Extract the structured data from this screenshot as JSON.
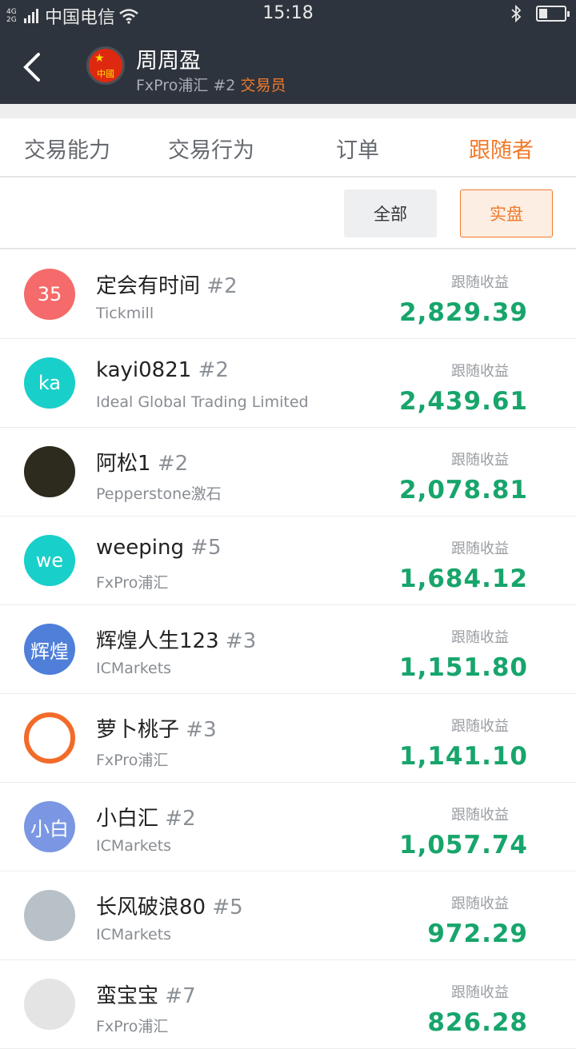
{
  "status": {
    "network": "4G 2G",
    "carrier": "中国电信",
    "time": "15:18"
  },
  "header": {
    "trader_name": "周周盈",
    "flag_text": "中國",
    "broker": "FxPro浦汇",
    "rank": "#2",
    "role": "交易员"
  },
  "tabs": [
    {
      "label": "交易能力"
    },
    {
      "label": "交易行为"
    },
    {
      "label": "订单"
    },
    {
      "label": "跟随者"
    }
  ],
  "filters": {
    "all": "全部",
    "real": "实盘"
  },
  "profit_label": "跟随收益",
  "followers": [
    {
      "avatar_text": "35",
      "avatar_color": "#f56a6a",
      "name": "定会有时间",
      "rank": "#2",
      "broker": "Tickmill",
      "profit": "2,829.39"
    },
    {
      "avatar_text": "ka",
      "avatar_color": "#19cfc9",
      "name": "kayi0821",
      "rank": "#2",
      "broker": "Ideal Global Trading Limited",
      "profit": "2,439.61"
    },
    {
      "avatar_text": "",
      "avatar_color": "#2d2a1e",
      "name": "阿松1",
      "rank": "#2",
      "broker": "Pepperstone激石",
      "profit": "2,078.81"
    },
    {
      "avatar_text": "we",
      "avatar_color": "#19cfc9",
      "name": "weeping",
      "rank": "#5",
      "broker": "FxPro浦汇",
      "profit": "1,684.12"
    },
    {
      "avatar_text": "辉煌",
      "avatar_color": "#4f7fd9",
      "name": "辉煌人生123",
      "rank": "#3",
      "broker": "ICMarkets",
      "profit": "1,151.80"
    },
    {
      "avatar_text": "",
      "avatar_color": "#ffffff",
      "name": "萝卜桃子",
      "rank": "#3",
      "broker": "FxPro浦汇",
      "profit": "1,141.10"
    },
    {
      "avatar_text": "小白",
      "avatar_color": "#7b97e3",
      "name": "小白汇",
      "rank": "#2",
      "broker": "ICMarkets",
      "profit": "1,057.74"
    },
    {
      "avatar_text": "",
      "avatar_color": "#b9c1c8",
      "name": "长风破浪80",
      "rank": "#5",
      "broker": "ICMarkets",
      "profit": "972.29"
    },
    {
      "avatar_text": "",
      "avatar_color": "#e4e4e4",
      "name": "蛮宝宝",
      "rank": "#7",
      "broker": "FxPro浦汇",
      "profit": "826.28"
    }
  ]
}
